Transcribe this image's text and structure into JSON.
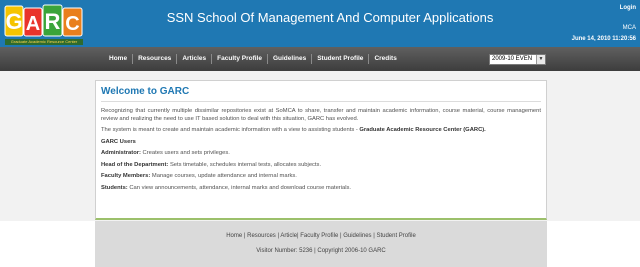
{
  "header": {
    "logo_text": "GARC",
    "logo_caption": "Graduate Academic Resource Center",
    "title": "SSN School Of Management And Computer Applications",
    "login": "Login",
    "user": "MCA",
    "datetime": "June 14, 2010 11:20:56"
  },
  "nav": {
    "items": [
      "Home",
      "Resources",
      "Articles",
      "Faculty Profile",
      "Guidelines",
      "Student Profile",
      "Credits"
    ],
    "term_selected": "2009-10 EVEN"
  },
  "main": {
    "heading": "Welcome to GARC",
    "intro": "Recognizing that currently multiple dissimilar repositories exist at SoMCA to share, transfer and maintain academic information, course material, course management review and realizing the need to use IT based solution to deal with this situation, GARC has evolved.",
    "purpose": "The system is meant to create and maintain academic information with a view to assisting students",
    "purpose_dash": " - ",
    "purpose_name": "Graduate Academic Resource Center (GARC).",
    "users_heading": "GARC Users",
    "roles": [
      {
        "role": "Administrator:",
        "desc": " Creates users and sets privileges."
      },
      {
        "role": "Head of the Department:",
        "desc": " Sets timetable, schedules internal tests, allocates subjects."
      },
      {
        "role": "Faculty Members:",
        "desc": " Manage courses, update attendance and internal marks."
      },
      {
        "role": "Students:",
        "desc": " Can view announcements, attendance, internal marks and download course materials."
      }
    ]
  },
  "footer": {
    "links": [
      "Home",
      "Resources",
      "Article",
      "Faculty Profile",
      "Guidelines",
      "Student Profile"
    ],
    "visitor": "Visitor Number: 5236 | Copyright 2006-10 GARC"
  },
  "colors": {
    "header_bg": "#1f78b3",
    "nav_bg": "#4a4a4a",
    "heading": "#1f78b3",
    "panel_accent": "#9cc06b"
  }
}
